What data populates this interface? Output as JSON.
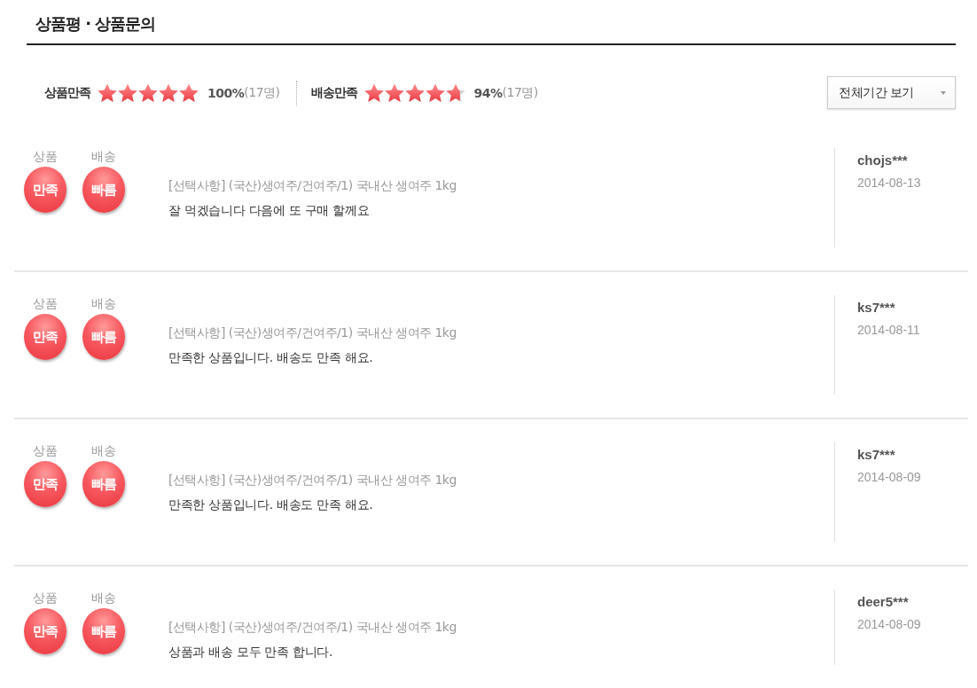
{
  "title": "상품평 · 상품문의",
  "summary": {
    "ratings": [
      {
        "label": "상품만족",
        "stars": 5,
        "score": "100%",
        "count": "(17명)"
      },
      {
        "label": "배송만족",
        "stars": 4.7,
        "score": "94%",
        "count": "(17명)"
      }
    ],
    "period_select": {
      "value": "전체기간 보기"
    }
  },
  "reviews": [
    {
      "badges": [
        {
          "label": "상품",
          "value": "만족"
        },
        {
          "label": "배송",
          "value": "빠름"
        }
      ],
      "option": "[선택사항] (국산)생여주/건여주/1) 국내산 생여주 1kg",
      "comment": "잘 먹겠습니다 다음에 또 구매 할께요",
      "user": "chojs***",
      "date": "2014-08-13"
    },
    {
      "badges": [
        {
          "label": "상품",
          "value": "만족"
        },
        {
          "label": "배송",
          "value": "빠름"
        }
      ],
      "option": "[선택사항] (국산)생여주/건여주/1) 국내산 생여주 1kg",
      "comment": "만족한 상품입니다. 배송도 만족 해요.",
      "user": "ks7***",
      "date": "2014-08-11"
    },
    {
      "badges": [
        {
          "label": "상품",
          "value": "만족"
        },
        {
          "label": "배송",
          "value": "빠름"
        }
      ],
      "option": "[선택사항] (국산)생여주/건여주/1) 국내산 생여주 1kg",
      "comment": "만족한 상품입니다. 배송도 만족 해요.",
      "user": "ks7***",
      "date": "2014-08-09"
    },
    {
      "badges": [
        {
          "label": "상품",
          "value": "만족"
        },
        {
          "label": "배송",
          "value": "빠름"
        }
      ],
      "option": "[선택사항] (국산)생여주/건여주/1) 국내산 생여주 1kg",
      "comment": "상품과 배송 모두 만족 합니다.",
      "user": "deer5***",
      "date": "2014-08-09"
    }
  ]
}
